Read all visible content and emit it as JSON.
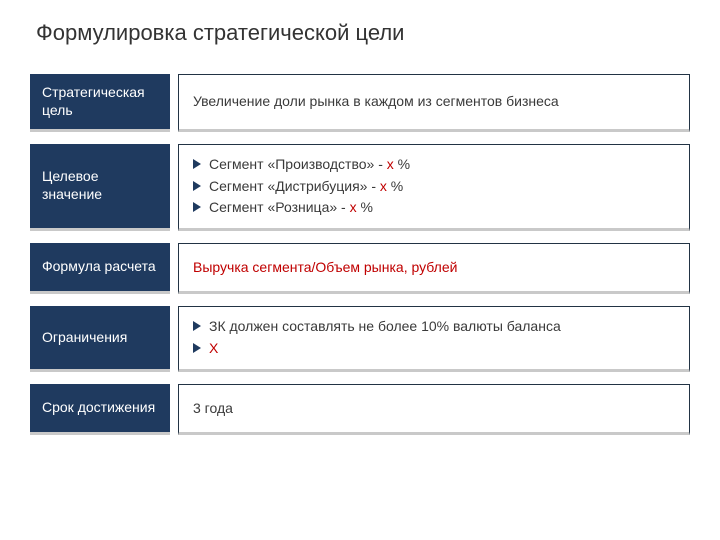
{
  "title": "Формулировка стратегической цели",
  "rows": {
    "goal": {
      "label": "Стратегическая цель",
      "text": "Увеличение доли рынка в каждом из сегментов бизнеса"
    },
    "target": {
      "label": "Целевое значение",
      "items": [
        {
          "pre": "Сегмент «Производство» - ",
          "red": "х",
          "post": " %"
        },
        {
          "pre": "Сегмент «Дистрибуция» - ",
          "red": "х",
          "post": " %"
        },
        {
          "pre": "Сегмент «Розница» - ",
          "red": "х",
          "post": " %"
        }
      ]
    },
    "formula": {
      "label": "Формула расчета",
      "text": "Выручка сегмента/Объем рынка, рублей"
    },
    "constraints": {
      "label": "Ограничения",
      "items": [
        {
          "pre": "ЗК должен составлять не более 10% валюты баланса",
          "red": "",
          "post": ""
        },
        {
          "pre": "",
          "red": "Х",
          "post": ""
        }
      ]
    },
    "deadline": {
      "label": "Срок достижения",
      "text": "3 года"
    }
  }
}
